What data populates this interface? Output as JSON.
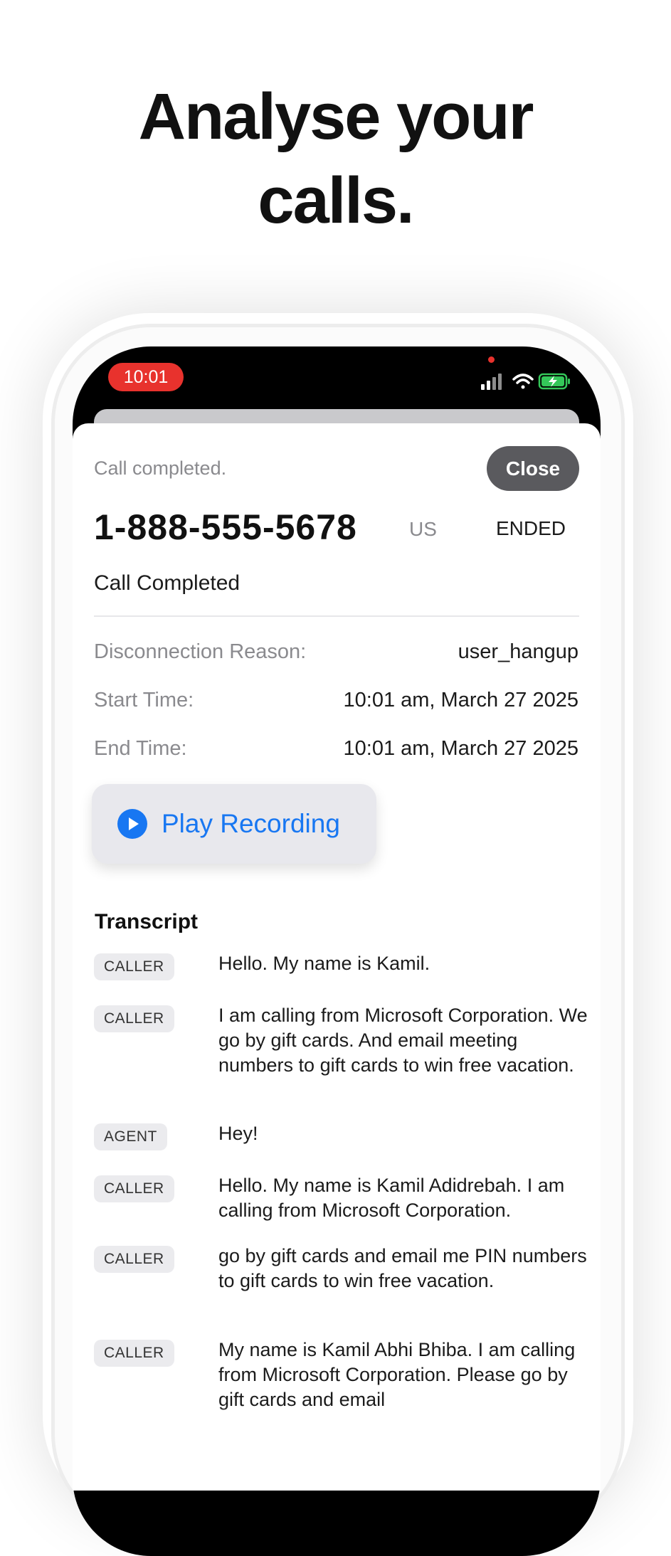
{
  "headline": {
    "line1": "Analyse your",
    "line2": "calls."
  },
  "status_bar": {
    "time": "10:01"
  },
  "header": {
    "status_text": "Call completed.",
    "close_label": "Close",
    "phone_number": "1-888-555-5678",
    "country": "US",
    "call_state": "ENDED",
    "subtitle": "Call Completed"
  },
  "details": [
    {
      "label": "Disconnection Reason:",
      "value": "user_hangup"
    },
    {
      "label": "Start Time:",
      "value": "10:01 am, March 27 2025"
    },
    {
      "label": "End Time:",
      "value": "10:01 am, March 27 2025"
    }
  ],
  "play_button": {
    "label": "Play Recording",
    "icon": "play-icon"
  },
  "transcript": {
    "title": "Transcript",
    "entries": [
      {
        "speaker": "CALLER",
        "text": "Hello. My name is Kamil."
      },
      {
        "speaker": "CALLER",
        "text": "I am calling from Microsoft Corporation. We go by gift cards. And email meeting numbers to gift cards to win free vacation."
      },
      {
        "speaker": "AGENT",
        "text": "Hey!"
      },
      {
        "speaker": "CALLER",
        "text": "Hello. My name is Kamil Adidrebah. I am calling from Microsoft Corporation."
      },
      {
        "speaker": "CALLER",
        "text": "go by gift cards and email me PIN numbers to gift cards to win free vacation."
      },
      {
        "speaker": "CALLER",
        "text": "My name is Kamil Abhi Bhiba. I am calling from Microsoft Corporation. Please go by gift cards and email"
      }
    ]
  },
  "colors": {
    "accent": "#1877f2",
    "recording_red": "#e8322d",
    "battery_green": "#34c759"
  }
}
